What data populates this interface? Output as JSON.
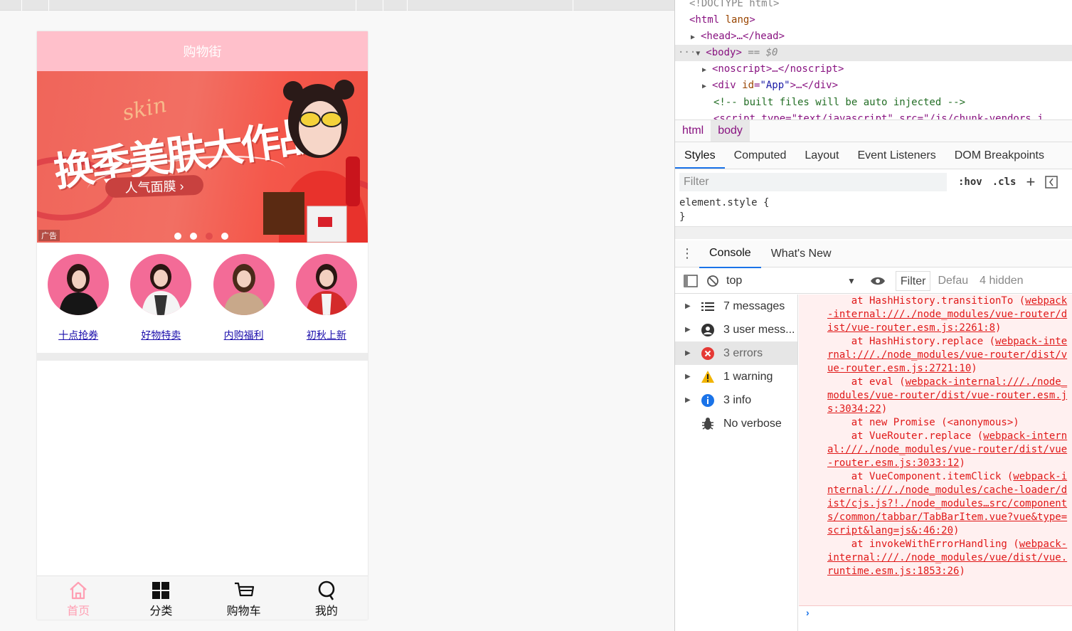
{
  "app": {
    "nav_title": "购物街",
    "banner": {
      "headline": "换季美肤大作战",
      "script": "skin",
      "pill": "人气面膜 ›",
      "ad_label": "广告",
      "dots": 4,
      "active_dot": 2
    },
    "recommend": [
      {
        "label": "十点抢券"
      },
      {
        "label": "好物特卖"
      },
      {
        "label": "内购福利"
      },
      {
        "label": "初秋上新"
      }
    ],
    "tabbar": [
      {
        "label": "首页",
        "icon": "home-icon",
        "active": true
      },
      {
        "label": "分类",
        "icon": "category-icon",
        "active": false
      },
      {
        "label": "购物车",
        "icon": "cart-icon",
        "active": false
      },
      {
        "label": "我的",
        "icon": "profile-icon",
        "active": false
      }
    ],
    "colors": {
      "nav_bg": "#ffc0cb",
      "active_tab": "#ff9fb3",
      "avatar_bg": "#f36b97"
    }
  },
  "devtools": {
    "elements": {
      "doctype": "<!DOCTYPE html>",
      "html_tag": "<html",
      "html_attr": "lang",
      "head": "<head>…</head>",
      "body": "<body>",
      "body_suffix": "== $0",
      "noscript": "<noscript>…</noscript>",
      "div_open": "<div",
      "div_attr": "id",
      "div_val": "\"App\"",
      "div_close": ">…</div>",
      "comment": "<!-- built files will be auto injected -->",
      "script_partial": "<script type=\"text/javascript\" src=\"/js/chunk-vendors.j"
    },
    "breadcrumbs": [
      "html",
      "body"
    ],
    "style_tabs": [
      "Styles",
      "Computed",
      "Layout",
      "Event Listeners",
      "DOM Breakpoints"
    ],
    "filter_placeholder": "Filter",
    "hov": ":hov",
    "cls": ".cls",
    "element_style": "element.style {",
    "element_style_close": "}",
    "console_tabs": [
      "Console",
      "What's New"
    ],
    "console_toolbar": {
      "context": "top",
      "filter": "Filter",
      "levels": "Defau",
      "hidden": "4 hidden"
    },
    "sidebar": [
      {
        "label": "7 messages",
        "icon": "list-icon"
      },
      {
        "label": "3 user mess...",
        "icon": "user-icon"
      },
      {
        "label": "3 errors",
        "icon": "error-icon"
      },
      {
        "label": "1 warning",
        "icon": "warning-icon"
      },
      {
        "label": "3 info",
        "icon": "info-icon"
      },
      {
        "label": "No verbose",
        "icon": "bug-icon"
      }
    ],
    "stack": [
      {
        "prefix": "    at HashHistory.transitionTo (",
        "link": "webpack-internal:///./node_modules/vue-router/dist/vue-router.esm.js:2261:8",
        "suffix": ")"
      },
      {
        "prefix": "    at HashHistory.replace (",
        "link": "webpack-internal:///./node_modules/vue-router/dist/vue-router.esm.js:2721:10",
        "suffix": ")"
      },
      {
        "prefix": "    at eval (",
        "link": "webpack-internal:///./node_modules/vue-router/dist/vue-router.esm.js:3034:22",
        "suffix": ")"
      },
      {
        "prefix": "    at new Promise (<anonymous>)",
        "link": "",
        "suffix": ""
      },
      {
        "prefix": "    at VueRouter.replace (",
        "link": "webpack-internal:///./node_modules/vue-router/dist/vue-router.esm.js:3033:12",
        "suffix": ")"
      },
      {
        "prefix": "    at VueComponent.itemClick (",
        "link": "webpack-internal:///./node_modules/cache-loader/dist/cjs.js?!./node_modules…src/components/common/tabbar/TabBarItem.vue?vue&type=script&lang=js&:46:20",
        "suffix": ")"
      },
      {
        "prefix": "    at invokeWithErrorHandling (",
        "link": "webpack-internal:///./node_modules/vue/dist/vue.runtime.esm.js:1853:26",
        "suffix": ")"
      }
    ],
    "prompt": "›"
  }
}
